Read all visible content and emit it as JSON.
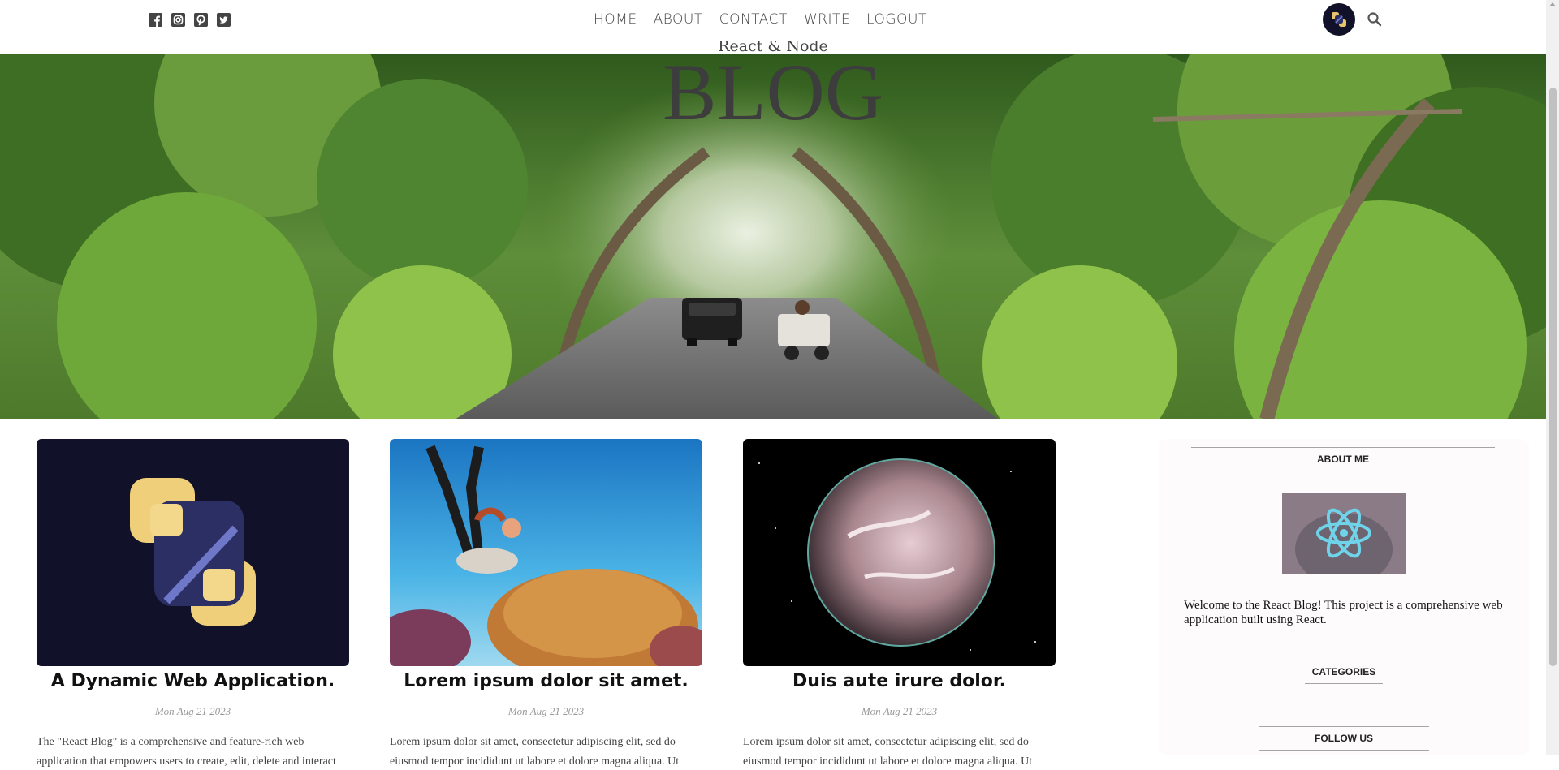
{
  "topbar": {
    "social_icons": [
      "facebook-square-icon",
      "instagram-square-icon",
      "pinterest-square-icon",
      "twitter-square-icon"
    ],
    "nav": [
      "HOME",
      "ABOUT",
      "CONTACT",
      "WRITE",
      "LOGOUT"
    ],
    "avatar_icon": "app-logo-icon",
    "search_icon": "search-icon"
  },
  "header": {
    "title_sm": "React & Node",
    "title_lg": "BLOG",
    "hero_image": "forest-road-image"
  },
  "posts": [
    {
      "image": "app-logo-image",
      "title": "A Dynamic Web Application.",
      "date": "Mon Aug 21 2023",
      "desc": "The \"React Blog\" is a comprehensive and feature-rich web application that empowers users to create, edit, delete and interact"
    },
    {
      "image": "diver-coral-image",
      "title": "Lorem ipsum dolor sit amet.",
      "date": "Mon Aug 21 2023",
      "desc": "Lorem ipsum dolor sit amet, consectetur adipiscing elit, sed do eiusmod tempor incididunt ut labore et dolore magna aliqua. Ut"
    },
    {
      "image": "planet-image",
      "title": "Duis aute irure dolor.",
      "date": "Mon Aug 21 2023",
      "desc": "Lorem ipsum dolor sit amet, consectetur adipiscing elit, sed do eiusmod tempor incididunt ut labore et dolore magna aliqua. Ut"
    }
  ],
  "sidebar": {
    "about_title": "ABOUT ME",
    "about_image": "react-logo-image",
    "about_text": "Welcome to the React Blog! This project is a comprehensive web application built using React.",
    "categories_title": "CATEGORIES",
    "follow_title": "FOLLOW US"
  },
  "colors": {
    "nav_text": "#444444",
    "avatar_bg": "#111229",
    "sidebar_bg": "#fdfbfb",
    "accent_gold": "#e9c46a"
  }
}
